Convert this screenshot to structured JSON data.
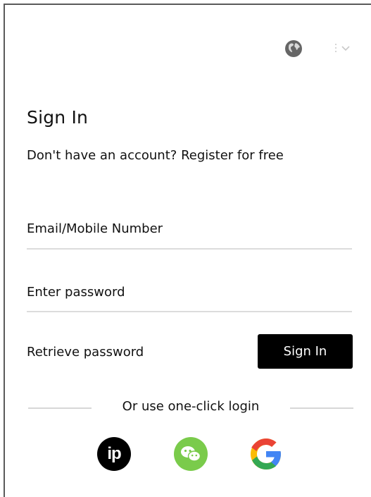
{
  "header": {
    "language_icon": "globe-icon",
    "language_dropdown_icon": "chevron-down-icon"
  },
  "form": {
    "title": "Sign In",
    "register_prompt": "Don't have an account?",
    "register_link": "Register for free",
    "email_placeholder": "Email/Mobile Number",
    "email_value": "",
    "password_placeholder": "Enter password",
    "password_value": "",
    "retrieve_password_label": "Retrieve password",
    "submit_label": "Sign In"
  },
  "social": {
    "divider_text": "Or use one-click login",
    "buttons": [
      {
        "icon": "ip-icon",
        "label": "ip",
        "color": "#000000"
      },
      {
        "icon": "wechat-icon",
        "color": "#7ACB4B"
      },
      {
        "icon": "google-icon",
        "colors": [
          "#4285F4",
          "#EA4335",
          "#FBBC05",
          "#34A853"
        ]
      }
    ]
  }
}
